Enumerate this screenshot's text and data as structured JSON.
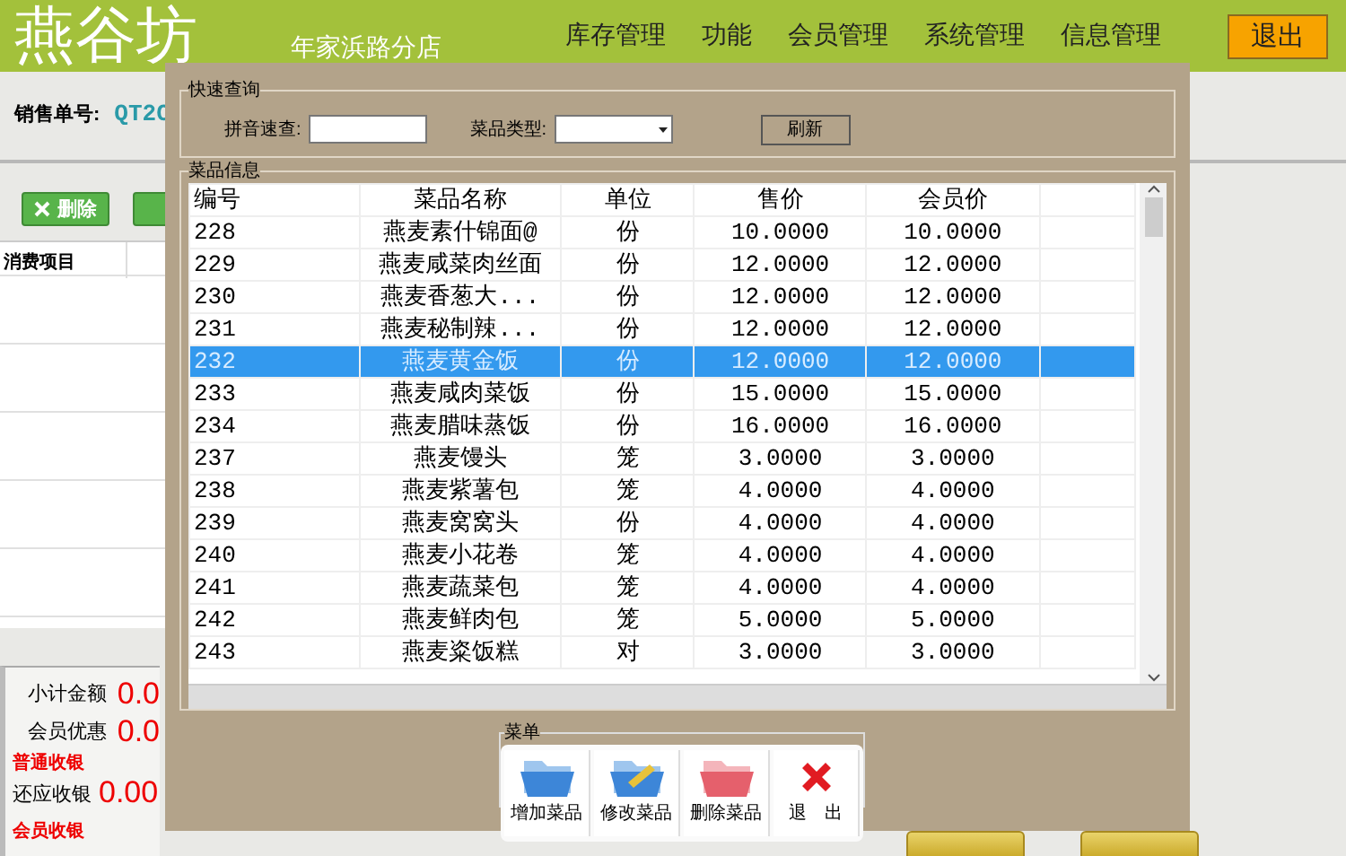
{
  "header": {
    "logo": "燕谷坊",
    "branch": "年家浜路分店",
    "menu": [
      "库存管理",
      "功能",
      "会员管理",
      "系统管理",
      "信息管理"
    ],
    "exit_button": "退出"
  },
  "order": {
    "label": "销售单号:",
    "value": "QT2C"
  },
  "delete_button": "删除",
  "consumption_table": {
    "columns": [
      "消费项目"
    ]
  },
  "totals": [
    {
      "label": "小计金额",
      "value": "0.0"
    },
    {
      "label": "会员优惠",
      "value": "0.0"
    }
  ],
  "normal_checkout": {
    "heading": "普通收银",
    "label": "还应收银",
    "value": "0.00"
  },
  "member_checkout": {
    "heading": "会员收银"
  },
  "dialog": {
    "quick_query": {
      "title": "快速查询",
      "pinyin_label": "拼音速查:",
      "type_label": "菜品类型:",
      "refresh_button": "刷新"
    },
    "dish_info": {
      "title": "菜品信息",
      "columns": [
        "编号",
        "菜品名称",
        "单位",
        "售价",
        "会员价"
      ],
      "rows": [
        {
          "cells": [
            "228",
            "燕麦素什锦面@",
            "份",
            "10.0000",
            "10.0000"
          ],
          "selected": false
        },
        {
          "cells": [
            "229",
            "燕麦咸菜肉丝面",
            "份",
            "12.0000",
            "12.0000"
          ],
          "selected": false
        },
        {
          "cells": [
            "230",
            "燕麦香葱大...",
            "份",
            "12.0000",
            "12.0000"
          ],
          "selected": false
        },
        {
          "cells": [
            "231",
            "燕麦秘制辣...",
            "份",
            "12.0000",
            "12.0000"
          ],
          "selected": false
        },
        {
          "cells": [
            "232",
            "燕麦黄金饭",
            "份",
            "12.0000",
            "12.0000"
          ],
          "selected": true
        },
        {
          "cells": [
            "233",
            "燕麦咸肉菜饭",
            "份",
            "15.0000",
            "15.0000"
          ],
          "selected": false
        },
        {
          "cells": [
            "234",
            "燕麦腊味蒸饭",
            "份",
            "16.0000",
            "16.0000"
          ],
          "selected": false
        },
        {
          "cells": [
            "237",
            "燕麦馒头",
            "笼",
            "3.0000",
            "3.0000"
          ],
          "selected": false
        },
        {
          "cells": [
            "238",
            "燕麦紫薯包",
            "笼",
            "4.0000",
            "4.0000"
          ],
          "selected": false
        },
        {
          "cells": [
            "239",
            "燕麦窝窝头",
            "份",
            "4.0000",
            "4.0000"
          ],
          "selected": false
        },
        {
          "cells": [
            "240",
            "燕麦小花卷",
            "笼",
            "4.0000",
            "4.0000"
          ],
          "selected": false
        },
        {
          "cells": [
            "241",
            "燕麦蔬菜包",
            "笼",
            "4.0000",
            "4.0000"
          ],
          "selected": false
        },
        {
          "cells": [
            "242",
            "燕麦鲜肉包",
            "笼",
            "5.0000",
            "5.0000"
          ],
          "selected": false
        },
        {
          "cells": [
            "243",
            "燕麦粢饭糕",
            "对",
            "3.0000",
            "3.0000"
          ],
          "selected": false
        }
      ]
    },
    "menu": {
      "title": "菜单",
      "buttons": [
        {
          "label": "增加菜品",
          "kind": "add"
        },
        {
          "label": "修改菜品",
          "kind": "edit"
        },
        {
          "label": "删除菜品",
          "kind": "delete"
        },
        {
          "label": "退　出",
          "kind": "exit"
        }
      ]
    }
  }
}
